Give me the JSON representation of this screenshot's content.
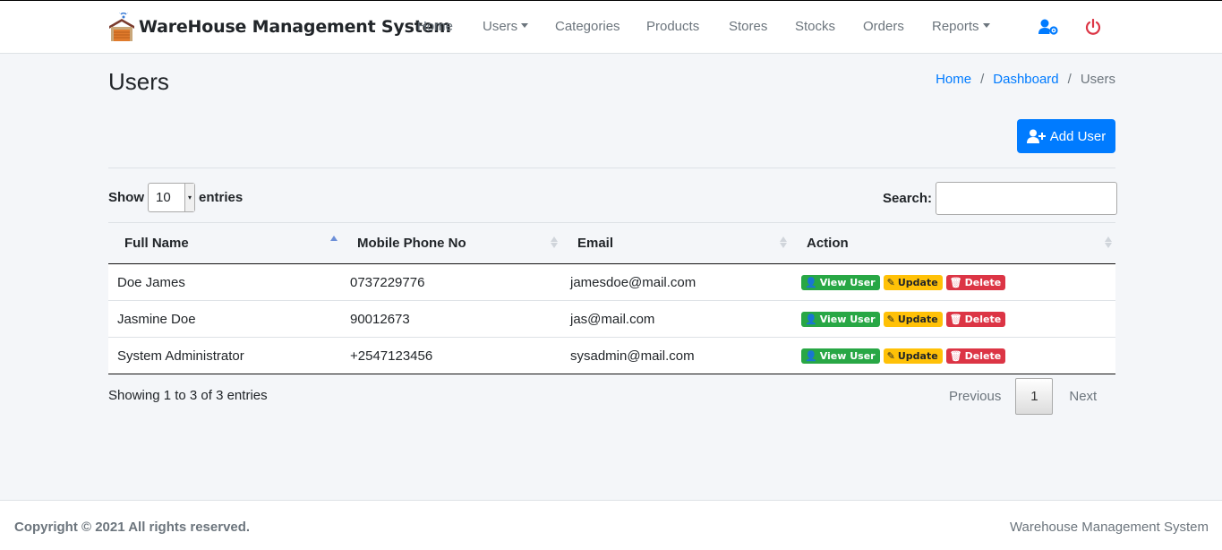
{
  "app": {
    "brand": "WareHouse Management System",
    "accent": "#007bff"
  },
  "nav": {
    "home": "Home",
    "users": "Users",
    "categories": "Categories",
    "products": "Products",
    "stores": "Stores",
    "stocks": "Stocks",
    "orders": "Orders",
    "reports": "Reports",
    "profile_icon": "user-cog-icon",
    "logout_icon": "power-icon"
  },
  "page": {
    "title": "Users",
    "breadcrumb": [
      "Home",
      "Dashboard",
      "Users"
    ],
    "add_button": "Add User"
  },
  "table": {
    "show_label": "Show",
    "entries_label": "entries",
    "page_length": "10",
    "search_label": "Search:",
    "search_value": "",
    "columns": [
      "Full Name",
      "Mobile Phone No",
      "Email",
      "Action"
    ],
    "rows": [
      {
        "name": "Doe James",
        "phone": "0737229776",
        "email": "jamesdoe@mail.com"
      },
      {
        "name": "Jasmine Doe",
        "phone": "90012673",
        "email": "jas@mail.com"
      },
      {
        "name": "System Administrator",
        "phone": "+2547123456",
        "email": "sysadmin@mail.com"
      }
    ],
    "actions": {
      "view": "View User",
      "update": "Update",
      "delete": "Delete"
    },
    "info": "Showing 1 to 3 of 3 entries",
    "pagination": {
      "previous": "Previous",
      "current": "1",
      "next": "Next"
    }
  },
  "footer": {
    "copyright": "Copyright © 2021 All rights reserved.",
    "system_name": "Warehouse Management System"
  }
}
